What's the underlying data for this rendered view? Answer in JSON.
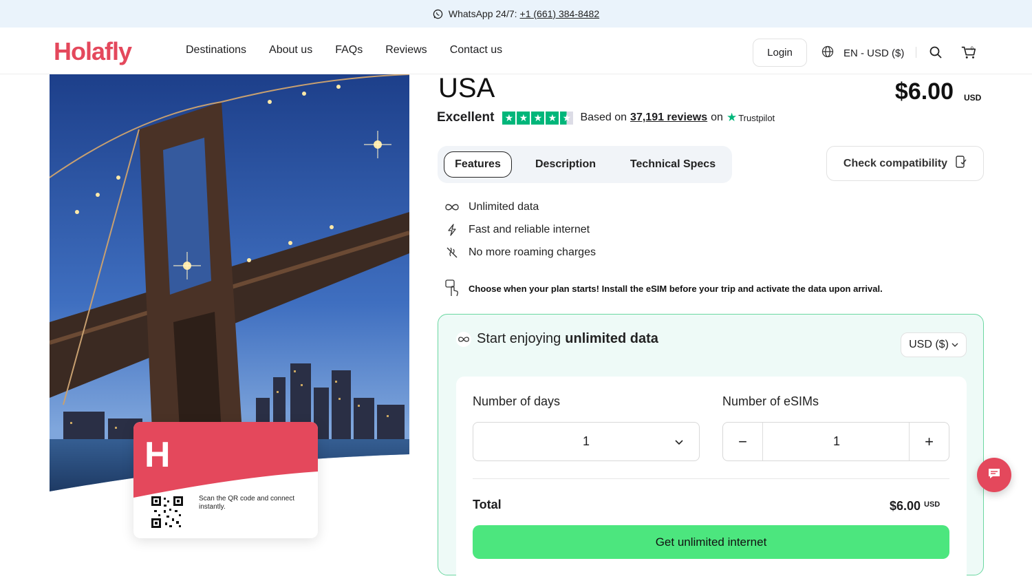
{
  "topbar": {
    "whatsapp_text": "WhatsApp 24/7:",
    "phone": "+1 (661) 384-8482"
  },
  "nav": {
    "logo": "Holafly",
    "links": [
      "Destinations",
      "About us",
      "FAQs",
      "Reviews",
      "Contact us"
    ],
    "login": "Login",
    "language": "EN - USD ($)",
    "cart_count": "0"
  },
  "esim_card": {
    "logo_mark": "H",
    "scan_text": "Scan the QR code and connect instantly."
  },
  "product": {
    "title": "USA",
    "price": "$6.00",
    "price_currency": "USD",
    "rating": {
      "label": "Excellent",
      "stars": 4.5,
      "based_on": "Based on",
      "reviews": "37,191 reviews",
      "on": "on",
      "provider": "Trustpilot"
    },
    "tabs": [
      "Features",
      "Description",
      "Technical Specs"
    ],
    "active_tab": "Features",
    "check_compat": "Check compatibility",
    "features": [
      {
        "icon": "infinity-icon",
        "text": "Unlimited data"
      },
      {
        "icon": "lightning-icon",
        "text": "Fast and reliable internet"
      },
      {
        "icon": "no-roaming-icon",
        "text": "No more roaming charges"
      }
    ],
    "notice": "Choose when your plan starts! Install the eSIM before your trip and activate the data upon arrival."
  },
  "booking": {
    "heading_prefix": "Start enjoying",
    "heading_bold": "unlimited data",
    "currency": "USD ($)",
    "days_label": "Number of days",
    "days_value": "1",
    "esims_label": "Number of eSIMs",
    "esims_value": "1",
    "minus": "−",
    "plus": "+",
    "total_label": "Total",
    "total_value": "$6.00",
    "total_currency": "USD",
    "cta": "Get unlimited internet"
  },
  "colors": {
    "brand": "#e4485c",
    "trustpilot": "#00b67a",
    "cta": "#4ce67e",
    "panel_bg": "#eefaf7",
    "panel_border": "#6ad7a0"
  }
}
